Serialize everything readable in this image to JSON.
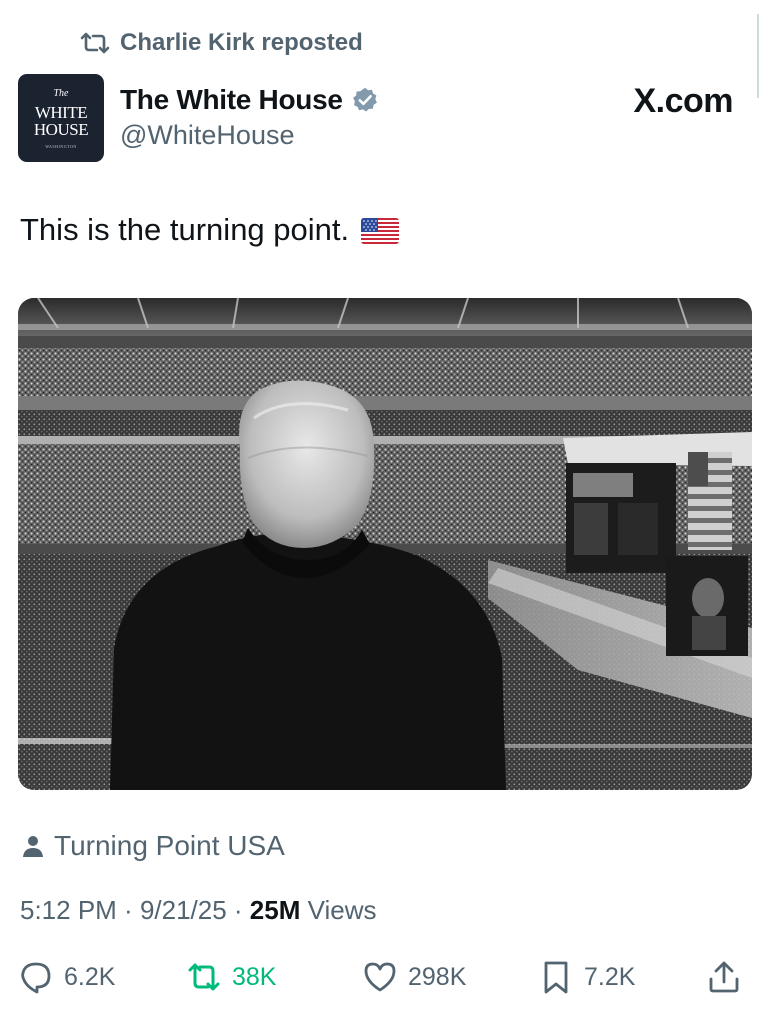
{
  "repost_context": {
    "text": "Charlie Kirk reposted",
    "icon": "repost-icon"
  },
  "author": {
    "avatar": {
      "line_the": "The",
      "line_white": "WHITE",
      "line_house": "HOUSE",
      "line_sub": "WASHINGTON",
      "background": "#1b2230"
    },
    "display_name": "The White House",
    "verified_icon": "verified-badge-icon",
    "verified_color": "#829aab",
    "handle": "@WhiteHouse"
  },
  "site_label": "X.com",
  "tweet": {
    "text": "This is the turning point.",
    "emoji": "us-flag-emoji"
  },
  "media": {
    "type": "photo",
    "style": "black-and-white"
  },
  "location": {
    "icon": "person-icon",
    "text": "Turning Point USA"
  },
  "meta": {
    "time": "5:12 PM",
    "separator": " · ",
    "date": "9/21/25",
    "views_count": "25M",
    "views_label": " Views"
  },
  "actions": {
    "reply": {
      "icon": "reply-icon",
      "count": "6.2K"
    },
    "repost": {
      "icon": "repost-icon",
      "count": "38K",
      "color": "#00ba7c"
    },
    "like": {
      "icon": "heart-icon",
      "count": "298K"
    },
    "bookmark": {
      "icon": "bookmark-icon",
      "count": "7.2K"
    },
    "share": {
      "icon": "share-icon"
    }
  },
  "colors": {
    "text_primary": "#0f1419",
    "text_secondary": "#536471",
    "repost_green": "#00ba7c"
  }
}
